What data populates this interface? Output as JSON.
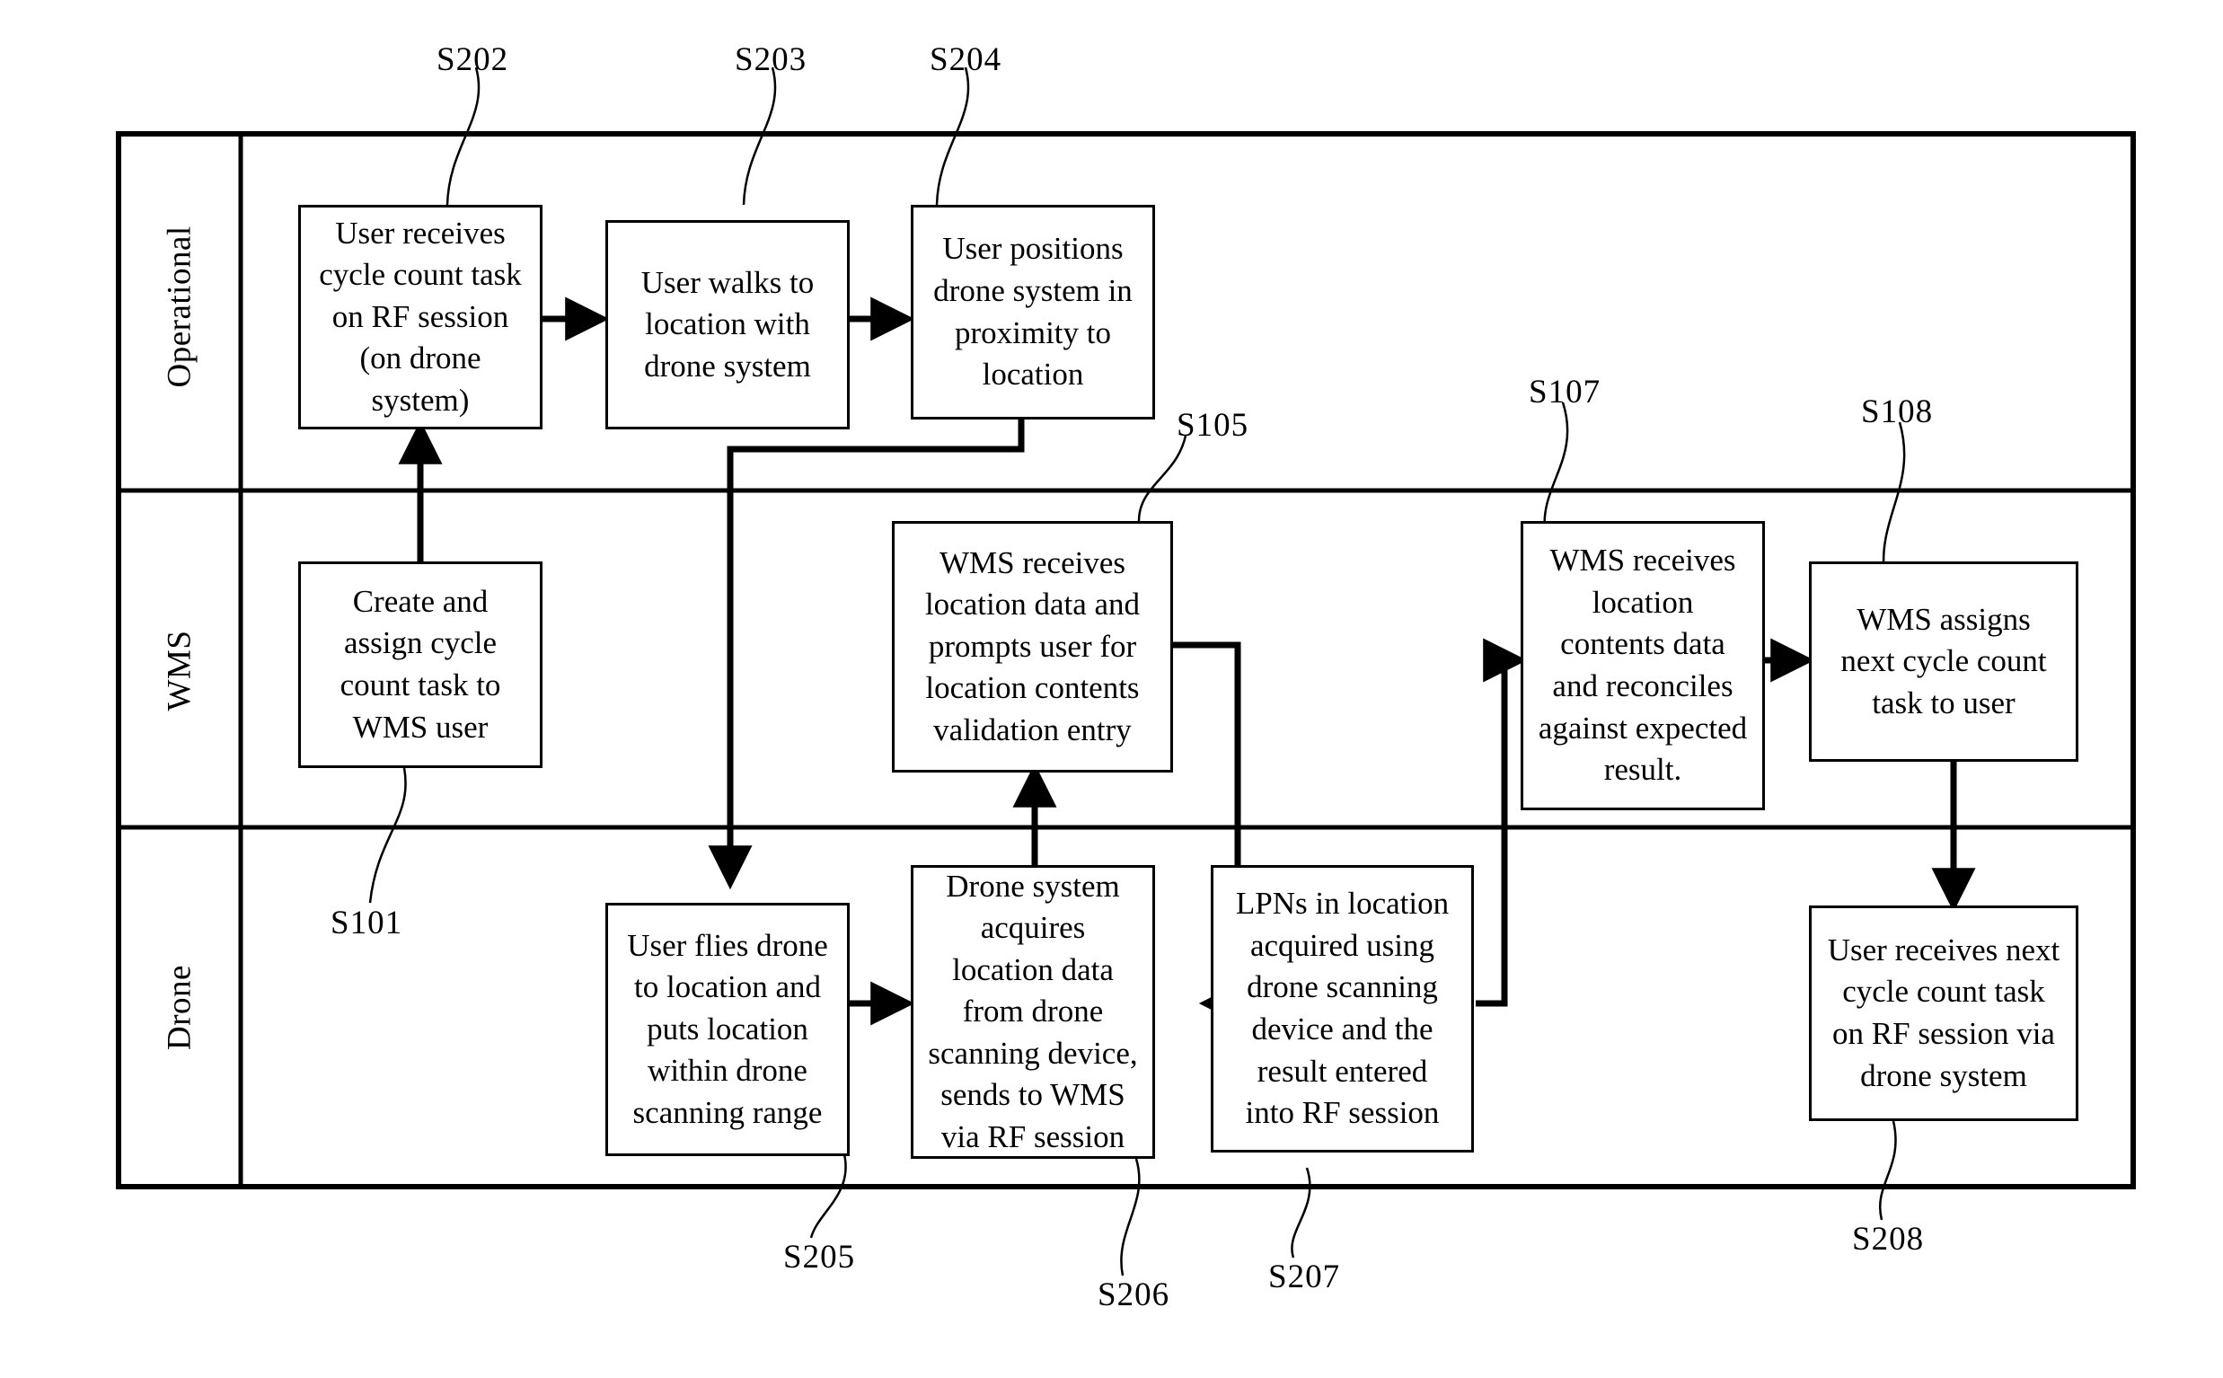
{
  "figure": {
    "type": "swimlane-flowchart",
    "lanes": [
      {
        "id": "operational",
        "label": "Operational"
      },
      {
        "id": "wms",
        "label": "WMS"
      },
      {
        "id": "drone",
        "label": "Drone"
      }
    ],
    "nodes": [
      {
        "id": "S202",
        "lane": "operational",
        "text": "User receives\ncycle count task\non RF session\n(on drone\nsystem)"
      },
      {
        "id": "S203",
        "lane": "operational",
        "text": "User walks to\nlocation with\ndrone system"
      },
      {
        "id": "S204",
        "lane": "operational",
        "text": "User positions\ndrone system in\nproximity to\nlocation"
      },
      {
        "id": "S101",
        "lane": "wms",
        "text": "Create and\nassign cycle\ncount task to\nWMS user"
      },
      {
        "id": "S105",
        "lane": "wms",
        "text": "WMS receives\nlocation data and\nprompts user for\nlocation contents\nvalidation entry"
      },
      {
        "id": "S107",
        "lane": "wms",
        "text": "WMS receives\nlocation\ncontents data\nand reconciles\nagainst expected\nresult."
      },
      {
        "id": "S108",
        "lane": "wms",
        "text": "WMS assigns\nnext cycle count\ntask to user"
      },
      {
        "id": "S205",
        "lane": "drone",
        "text": "User flies drone\nto location and\nputs location\nwithin drone\nscanning range"
      },
      {
        "id": "S206",
        "lane": "drone",
        "text": "Drone system\nacquires\nlocation data\nfrom drone\nscanning device,\nsends to WMS\nvia RF session"
      },
      {
        "id": "S207",
        "lane": "drone",
        "text": "LPNs in location\nacquired using\ndrone scanning\ndevice and the\nresult entered\ninto RF session"
      },
      {
        "id": "S208",
        "lane": "drone",
        "text": "User receives next\ncycle count task\non RF session via\ndrone system"
      }
    ],
    "reference_labels": [
      {
        "id": "ref-S202",
        "text": "S202"
      },
      {
        "id": "ref-S203",
        "text": "S203"
      },
      {
        "id": "ref-S204",
        "text": "S204"
      },
      {
        "id": "ref-S105",
        "text": "S105"
      },
      {
        "id": "ref-S107",
        "text": "S107"
      },
      {
        "id": "ref-S108",
        "text": "S108"
      },
      {
        "id": "ref-S101",
        "text": "S101"
      },
      {
        "id": "ref-S205",
        "text": "S205"
      },
      {
        "id": "ref-S206",
        "text": "S206"
      },
      {
        "id": "ref-S207",
        "text": "S207"
      },
      {
        "id": "ref-S208",
        "text": "S208"
      }
    ],
    "connections": [
      {
        "from": "S101",
        "to": "S202"
      },
      {
        "from": "S202",
        "to": "S203"
      },
      {
        "from": "S203",
        "to": "S204"
      },
      {
        "from": "S204",
        "to": "S205"
      },
      {
        "from": "S205",
        "to": "S206"
      },
      {
        "from": "S206",
        "to": "S105"
      },
      {
        "from": "S105",
        "to": "S207"
      },
      {
        "from": "S207",
        "to": "S107"
      },
      {
        "from": "S107",
        "to": "S108"
      },
      {
        "from": "S108",
        "to": "S208"
      }
    ],
    "colors": {
      "stroke": "#000000",
      "background": "#ffffff"
    }
  }
}
